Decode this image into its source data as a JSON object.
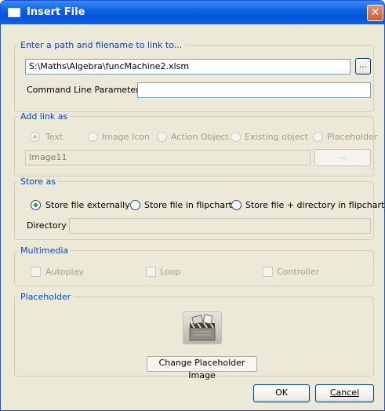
{
  "window": {
    "title": "Insert File",
    "close_glyph": "✕"
  },
  "path_group": {
    "legend": "Enter a path and filename to link to...",
    "path_value": "S:\\Maths\\Algebra\\funcMachine2.xlsm",
    "browse_label": "...",
    "cmd_label": "Command Line Parameters",
    "cmd_value": ""
  },
  "link_group": {
    "legend": "Add link as",
    "options": [
      "Text",
      "Image Icon",
      "Action Object",
      "Existing object",
      "Placeholder"
    ],
    "selected": "Text",
    "text_value": "Image11",
    "browse_label": "..."
  },
  "store_group": {
    "legend": "Store as",
    "options": [
      "Store file externally",
      "Store file in flipchart",
      "Store file + directory in flipchart"
    ],
    "selected": "Store file externally",
    "directory_label": "Directory",
    "directory_value": ""
  },
  "multimedia_group": {
    "legend": "Multimedia",
    "options": [
      "Autoplay",
      "Loop",
      "Controller"
    ]
  },
  "placeholder_group": {
    "legend": "Placeholder",
    "image_icon": "placeholder-film-clapper-icon",
    "change_label": "Change Placeholder Image"
  },
  "footer": {
    "ok_label": "OK",
    "cancel_label": "Cancel"
  },
  "colors": {
    "title_bar": "#0a5ce0",
    "legend_text": "#0046d5",
    "dialog_bg": "#ece9d8",
    "radio_dot": "#21a121"
  }
}
